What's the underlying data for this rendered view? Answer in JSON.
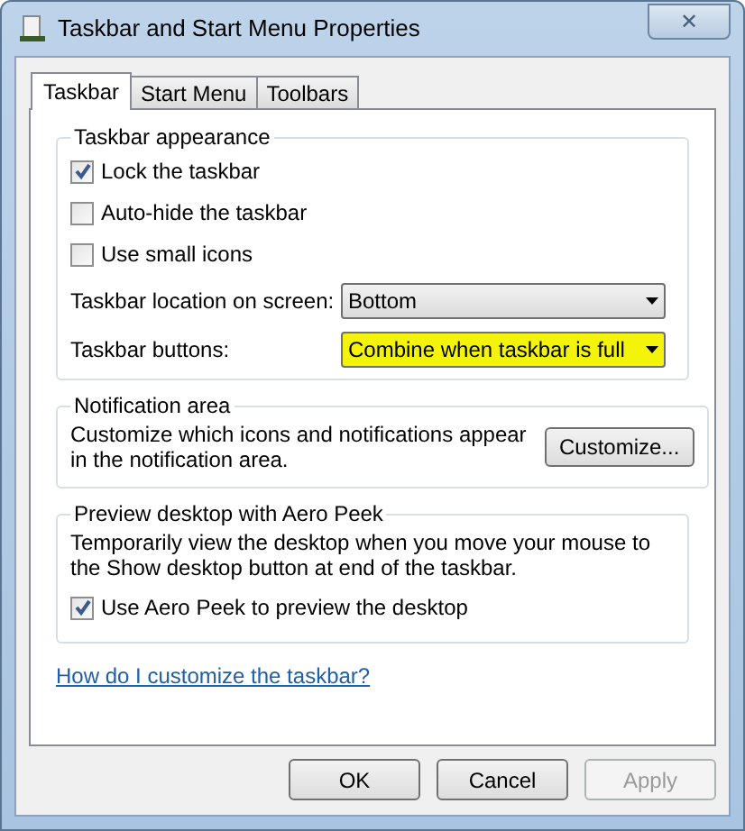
{
  "window": {
    "title": "Taskbar and Start Menu Properties",
    "close": "✕"
  },
  "tabs": [
    {
      "label": "Taskbar",
      "selected": true
    },
    {
      "label": "Start Menu",
      "selected": false
    },
    {
      "label": "Toolbars",
      "selected": false
    }
  ],
  "appearance": {
    "legend": "Taskbar appearance",
    "checkboxes": [
      {
        "label": "Lock the taskbar",
        "checked": true
      },
      {
        "label": "Auto-hide the taskbar",
        "checked": false
      },
      {
        "label": "Use small icons",
        "checked": false
      }
    ],
    "dropdowns": [
      {
        "label": "Taskbar location on screen:",
        "value": "Bottom",
        "highlighted": false
      },
      {
        "label": "Taskbar buttons:",
        "value": "Combine when taskbar is full",
        "highlighted": true
      }
    ]
  },
  "notification": {
    "legend": "Notification area",
    "text": "Customize which icons and notifications appear in the notification area.",
    "button": "Customize..."
  },
  "peek": {
    "legend": "Preview desktop with Aero Peek",
    "text": "Temporarily view the desktop when you move your mouse to the Show desktop button at end of the taskbar.",
    "checkbox": {
      "label": "Use Aero Peek to preview the desktop",
      "checked": true
    }
  },
  "help_link": "How do I customize the taskbar?",
  "buttons": [
    {
      "label": "OK",
      "disabled": false
    },
    {
      "label": "Cancel",
      "disabled": false
    },
    {
      "label": "Apply",
      "disabled": true
    }
  ]
}
